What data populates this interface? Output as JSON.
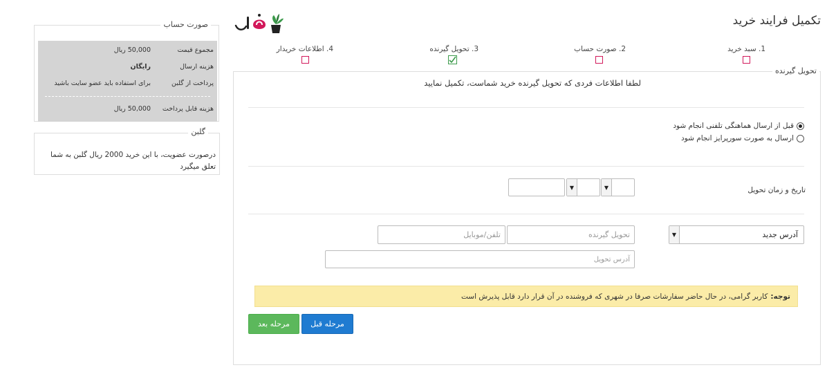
{
  "header": {
    "title": "تکمیل فرایند خرید"
  },
  "steps": [
    {
      "label": "1. سبد خرید",
      "checked": false
    },
    {
      "label": "2. صورت حساب",
      "checked": false
    },
    {
      "label": "3. تحویل گیرنده",
      "checked": true
    },
    {
      "label": "4. اطلاعات خریدار",
      "checked": false
    }
  ],
  "delivery": {
    "legend": "تحویل گیرنده",
    "intro": "لطفا اطلاعات فردی که تحویل گیرنده خرید شماست، تکمیل نمایید",
    "options": [
      {
        "label": "قبل از ارسال هماهنگی تلفنی انجام شود",
        "selected": true
      },
      {
        "label": "ارسال به صورت سورپرایز انجام شود",
        "selected": false
      }
    ],
    "date_label": "تاریخ و زمان تحویل",
    "address_select": "آدرس جدید",
    "receiver_placeholder": "تحویل گیرنده",
    "phone_placeholder": "تلفن/موبایل",
    "address_placeholder": "آدرس تحویل",
    "note_bold": "توجه:",
    "note_text": "کاربر گرامی، در حال حاضر سفارشات صرفا در شهری که فروشنده در آن قرار دارد قابل پذیرش است",
    "prev_button": "مرحله قبل",
    "next_button": "مرحله بعد"
  },
  "invoice": {
    "legend": "صورت حساب",
    "rows": [
      {
        "label": "مجموع قیمت",
        "value": "50,000 ریال"
      },
      {
        "label": "هزینه ارسال",
        "value": "رایگان"
      },
      {
        "label": "پرداخت از گلبن",
        "value": "برای استفاده باید عضو سایت باشید"
      },
      {
        "label": "هزینه قابل پرداخت",
        "value": "50,000 ریال"
      }
    ]
  },
  "golban": {
    "legend": "گلبن",
    "text": "درصورت عضویت، با این خرید 2000 ریال گلبن به شما تعلق میگیرد"
  },
  "colors": {
    "accent_red": "#d2185a",
    "check_green": "#3c9a4b",
    "btn_green": "#5cb85c",
    "btn_blue": "#1f7bd1",
    "note_bg": "#fbeca8"
  }
}
